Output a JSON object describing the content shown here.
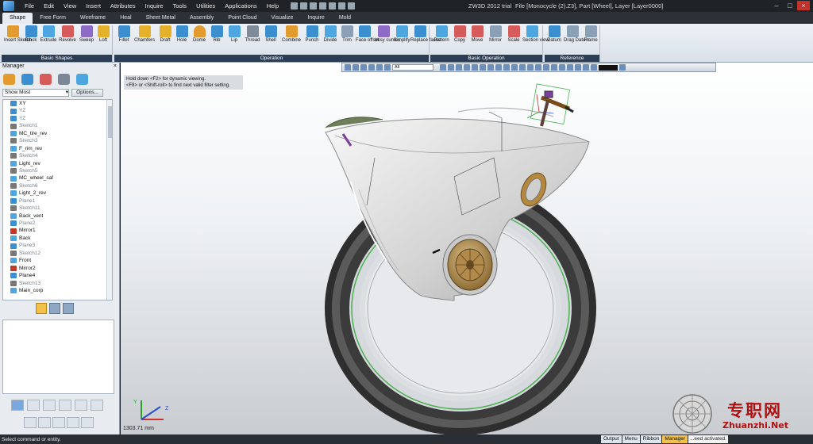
{
  "title_bar": {
    "app_title": "ZW3D 2012 trial",
    "file_info": "File [Monocycle (2).Z3],  Part [Wheel],  Layer [Layer0000]",
    "menus": [
      "File",
      "Edit",
      "View",
      "Insert",
      "Attributes",
      "Inquire",
      "Tools",
      "Utilities",
      "Applications",
      "Help"
    ]
  },
  "ribbon_tabs": [
    "Shape",
    "Free Form",
    "Wireframe",
    "Heal",
    "Sheet Metal",
    "Assembly",
    "Point Cloud",
    "Visualize",
    "Inquire",
    "Mold"
  ],
  "ribbon_groups": {
    "basic_shapes": {
      "title": "Basic Shapes",
      "buttons": [
        "Insert Sketch",
        "Block",
        "Extrude",
        "Revolve",
        "Sweep",
        "Loft"
      ]
    },
    "operation": {
      "title": "Operation",
      "buttons": [
        "Fillet",
        "Chamfers",
        "Draft",
        "Hole",
        "Dome",
        "Rib",
        "Lip",
        "Thread",
        "Shell",
        "Combine",
        "Punch",
        "Divide",
        "Trim",
        "Face offset",
        "Imsy curves",
        "Simplify",
        "Replace faces"
      ]
    },
    "basic_operation": {
      "title": "Basic Operation",
      "buttons": [
        "Pattern",
        "Copy",
        "Move",
        "Mirror",
        "Scale",
        "Section view"
      ]
    },
    "reference": {
      "title": "Reference",
      "buttons": [
        "Datum",
        "Drag Datum",
        "Frame"
      ]
    }
  },
  "manager": {
    "title": "Manager",
    "filter_value": "Show Most",
    "options_label": "Options...",
    "tree": [
      {
        "label": "XY",
        "dim": false,
        "icon": "plane"
      },
      {
        "label": "YZ",
        "dim": true,
        "icon": "plane"
      },
      {
        "label": "YZ",
        "dim": true,
        "icon": "plane"
      },
      {
        "label": "Sketch1",
        "dim": true,
        "icon": "sketch"
      },
      {
        "label": "MC_tire_rev",
        "dim": false,
        "icon": "feature"
      },
      {
        "label": "Sketch3",
        "dim": true,
        "icon": "sketch"
      },
      {
        "label": "F_rim_rev",
        "dim": false,
        "icon": "feature"
      },
      {
        "label": "Sketch4",
        "dim": true,
        "icon": "sketch"
      },
      {
        "label": "Light_rev",
        "dim": false,
        "icon": "feature"
      },
      {
        "label": "Sketch5",
        "dim": true,
        "icon": "sketch"
      },
      {
        "label": "MC_wheel_saf",
        "dim": false,
        "icon": "feature"
      },
      {
        "label": "Sketch6",
        "dim": true,
        "icon": "sketch"
      },
      {
        "label": "Light_2_rev",
        "dim": false,
        "icon": "feature"
      },
      {
        "label": "Plane1",
        "dim": true,
        "icon": "plane"
      },
      {
        "label": "Sketch11",
        "dim": true,
        "icon": "sketch"
      },
      {
        "label": "Back_vent",
        "dim": false,
        "icon": "feature"
      },
      {
        "label": "Plane2",
        "dim": true,
        "icon": "plane"
      },
      {
        "label": "Mirror1",
        "dim": false,
        "icon": "mirror"
      },
      {
        "label": "Back",
        "dim": false,
        "icon": "feature"
      },
      {
        "label": "Plane3",
        "dim": true,
        "icon": "plane"
      },
      {
        "label": "Sketch12",
        "dim": true,
        "icon": "sketch"
      },
      {
        "label": "Front",
        "dim": false,
        "icon": "feature"
      },
      {
        "label": "Mirror2",
        "dim": false,
        "icon": "mirror"
      },
      {
        "label": "Plane4",
        "dim": false,
        "icon": "plane"
      },
      {
        "label": "Sketch13",
        "dim": true,
        "icon": "sketch"
      },
      {
        "label": "Main_corp",
        "dim": false,
        "icon": "feature"
      }
    ]
  },
  "viewport": {
    "hint_line1": "Hold down <F2> for dynamic viewing.",
    "hint_line2": "<F8> or <Shift-roll> to find next valid filter setting.",
    "filter_field": "All",
    "scale_text": "1303.71 mm"
  },
  "status": {
    "prompt": "Select command or entity.",
    "tabs": [
      "Output",
      "Menu",
      "Ribbon",
      "Manager"
    ],
    "active_tab": "Manager",
    "message": "...eed activated."
  },
  "watermark": {
    "cn": "专职网",
    "en": "Zhuanzhi.Net"
  },
  "colors": {
    "accent": "#f1c14b",
    "ribbon_title": "#2c3e55",
    "tire": "#2b2b2b",
    "body": "#dcdcdc",
    "hub": "#b0894a"
  }
}
